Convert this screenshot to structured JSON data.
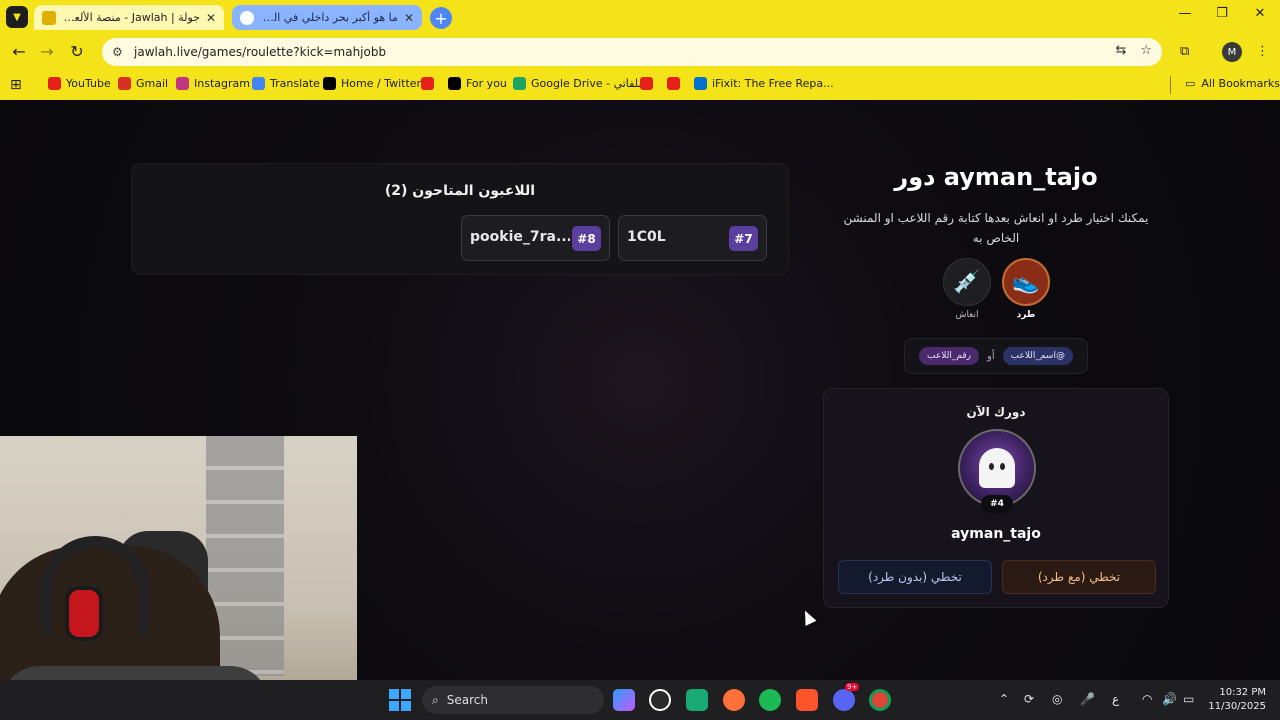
{
  "browser": {
    "tabs": [
      {
        "title": "جولة | Jawlah - منصة الألعاب الت...",
        "active": true
      },
      {
        "title": "ما هو أكبر بحر داخلي في العالم؟",
        "active": false
      }
    ],
    "url": "jawlah.live/games/roulette?kick=mahjobb",
    "profile_initial": "M",
    "bookmarks": [
      "YouTube",
      "Gmail",
      "Instagram",
      "Translate",
      "Home / Twitter",
      "For you",
      "Google Drive - ملفاتي",
      "iFixit: The Free Repa..."
    ],
    "all_bookmarks": "All Bookmarks"
  },
  "players": {
    "title": "اللاعبون المتاحون (2)",
    "list": [
      {
        "name": "pookie_7ra...",
        "number": "#8"
      },
      {
        "name": "1C0L",
        "number": "#7"
      }
    ]
  },
  "turn": {
    "title": "دور ayman_tajo",
    "description": "يمكنك اختيار طرد او انعاش بعدها كتابة رقم اللاعب او المنشن الخاص به",
    "actions": {
      "kick": "طرد",
      "revive": "انعاش"
    },
    "hint": {
      "name_chip": "@اسم_اللاعب",
      "or": "أو",
      "number_chip": "رقم_اللاعب"
    }
  },
  "current": {
    "title": "دورك الآن",
    "badge": "#4",
    "name": "ayman_tajo",
    "skip_with_kick": "تخطي (مع طرد)",
    "skip_without_kick": "تخطي (بدون طرد)"
  },
  "taskbar": {
    "search": "Search",
    "lang": "ع",
    "time": "10:32 PM",
    "date": "11/30/2025",
    "discord_badge": "9+"
  },
  "colors": {
    "chrome_yellow": "#f5e31a",
    "player_number_bg": "#5b3f9e",
    "kick_action": "#8a2d17"
  }
}
